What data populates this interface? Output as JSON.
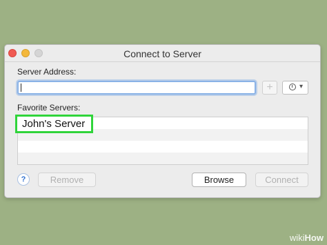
{
  "window": {
    "title": "Connect to Server"
  },
  "server_address": {
    "label": "Server Address:",
    "value": ""
  },
  "favorites": {
    "label": "Favorite Servers:",
    "items": [
      "John's Server"
    ]
  },
  "buttons": {
    "add": "+",
    "help": "?",
    "remove": "Remove",
    "browse": "Browse",
    "connect": "Connect"
  },
  "watermark": {
    "wiki": "wiki",
    "how": "How"
  }
}
